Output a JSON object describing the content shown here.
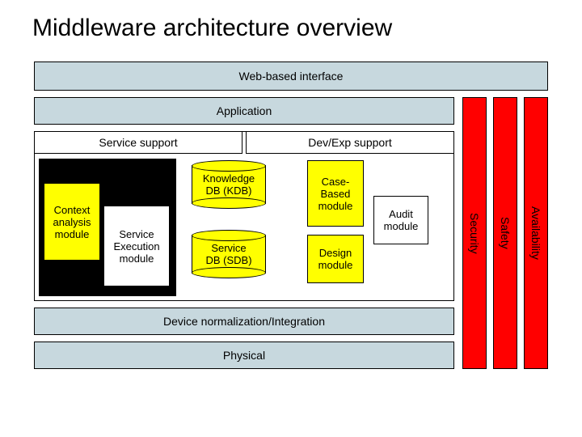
{
  "title": "Middleware architecture overview",
  "layers": {
    "web_interface": "Web-based interface",
    "application": "Application",
    "service_support": "Service support",
    "devexp_support": "Dev/Exp support",
    "device_norm": "Device normalization/Integration",
    "physical": "Physical"
  },
  "modules": {
    "context_analysis": "Context\nanalysis\nmodule",
    "service_execution": "Service\nExecution\nmodule",
    "knowledge_db": "Knowledge\nDB (KDB)",
    "service_db": "Service\nDB (SDB)",
    "case_based": "Case-\nBased\nmodule",
    "design": "Design\nmodule",
    "audit": "Audit\nmodule"
  },
  "pillars": {
    "security": "Security",
    "safety": "Safety",
    "availability": "Availability"
  }
}
